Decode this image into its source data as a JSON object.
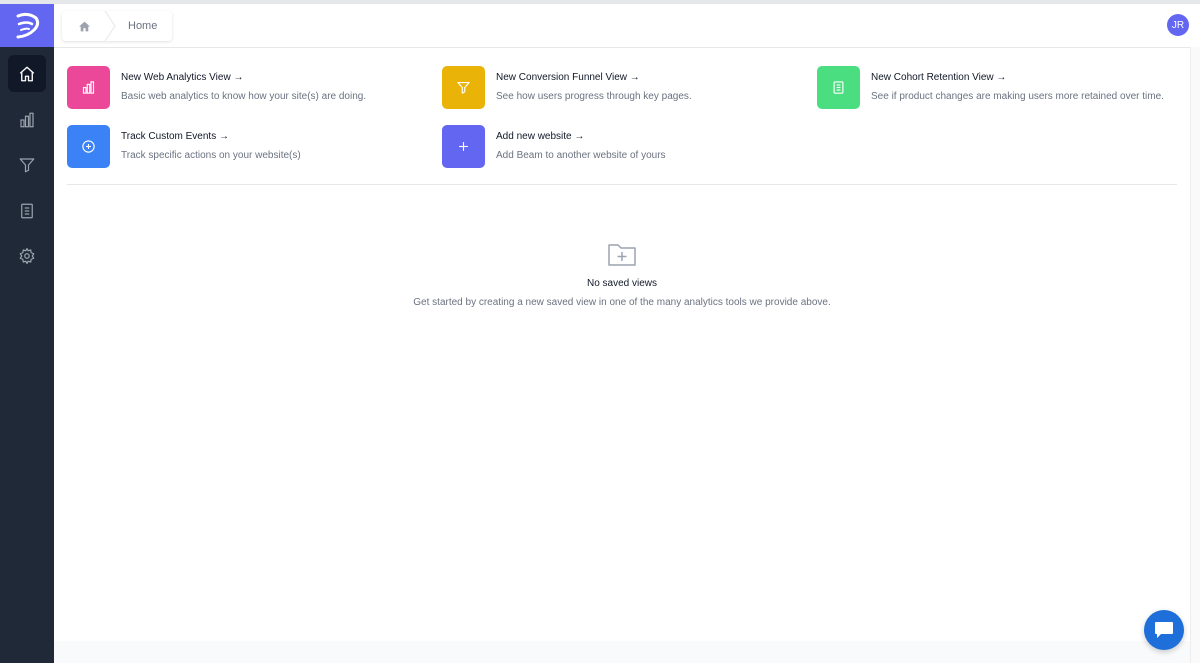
{
  "header": {
    "breadcrumb_label": "Home",
    "avatar_initials": "JR"
  },
  "sidebar": {
    "items": [
      {
        "icon": "home-icon",
        "active": true
      },
      {
        "icon": "bar-chart-icon",
        "active": false
      },
      {
        "icon": "funnel-icon",
        "active": false
      },
      {
        "icon": "clipboard-icon",
        "active": false
      },
      {
        "icon": "gear-icon",
        "active": false
      }
    ]
  },
  "actions": [
    {
      "title": "New Web Analytics View →",
      "desc": "Basic web analytics to know how your site(s) are doing.",
      "icon": "bar-chart-icon",
      "color": "#ec4899"
    },
    {
      "title": "New Conversion Funnel View →",
      "desc": "See how users progress through key pages.",
      "icon": "funnel-icon",
      "color": "#eab308"
    },
    {
      "title": "New Cohort Retention View →",
      "desc": "See if product changes are making users more retained over time.",
      "icon": "clipboard-icon",
      "color": "#4ade80"
    },
    {
      "title": "Track Custom Events →",
      "desc": "Track specific actions on your website(s)",
      "icon": "plus-circle-icon",
      "color": "#3b82f6"
    },
    {
      "title": "Add new website →",
      "desc": "Add Beam to another website of yours",
      "icon": "plus-icon",
      "color": "#6366f1"
    }
  ],
  "empty_state": {
    "icon": "folder-plus-icon",
    "title": "No saved views",
    "description": "Get started by creating a new saved view in one of the many analytics tools we provide above."
  },
  "colors": {
    "sidebar": "#1f2937",
    "logo_bg": "#6366f1",
    "chat_button": "#1e6fd9"
  }
}
